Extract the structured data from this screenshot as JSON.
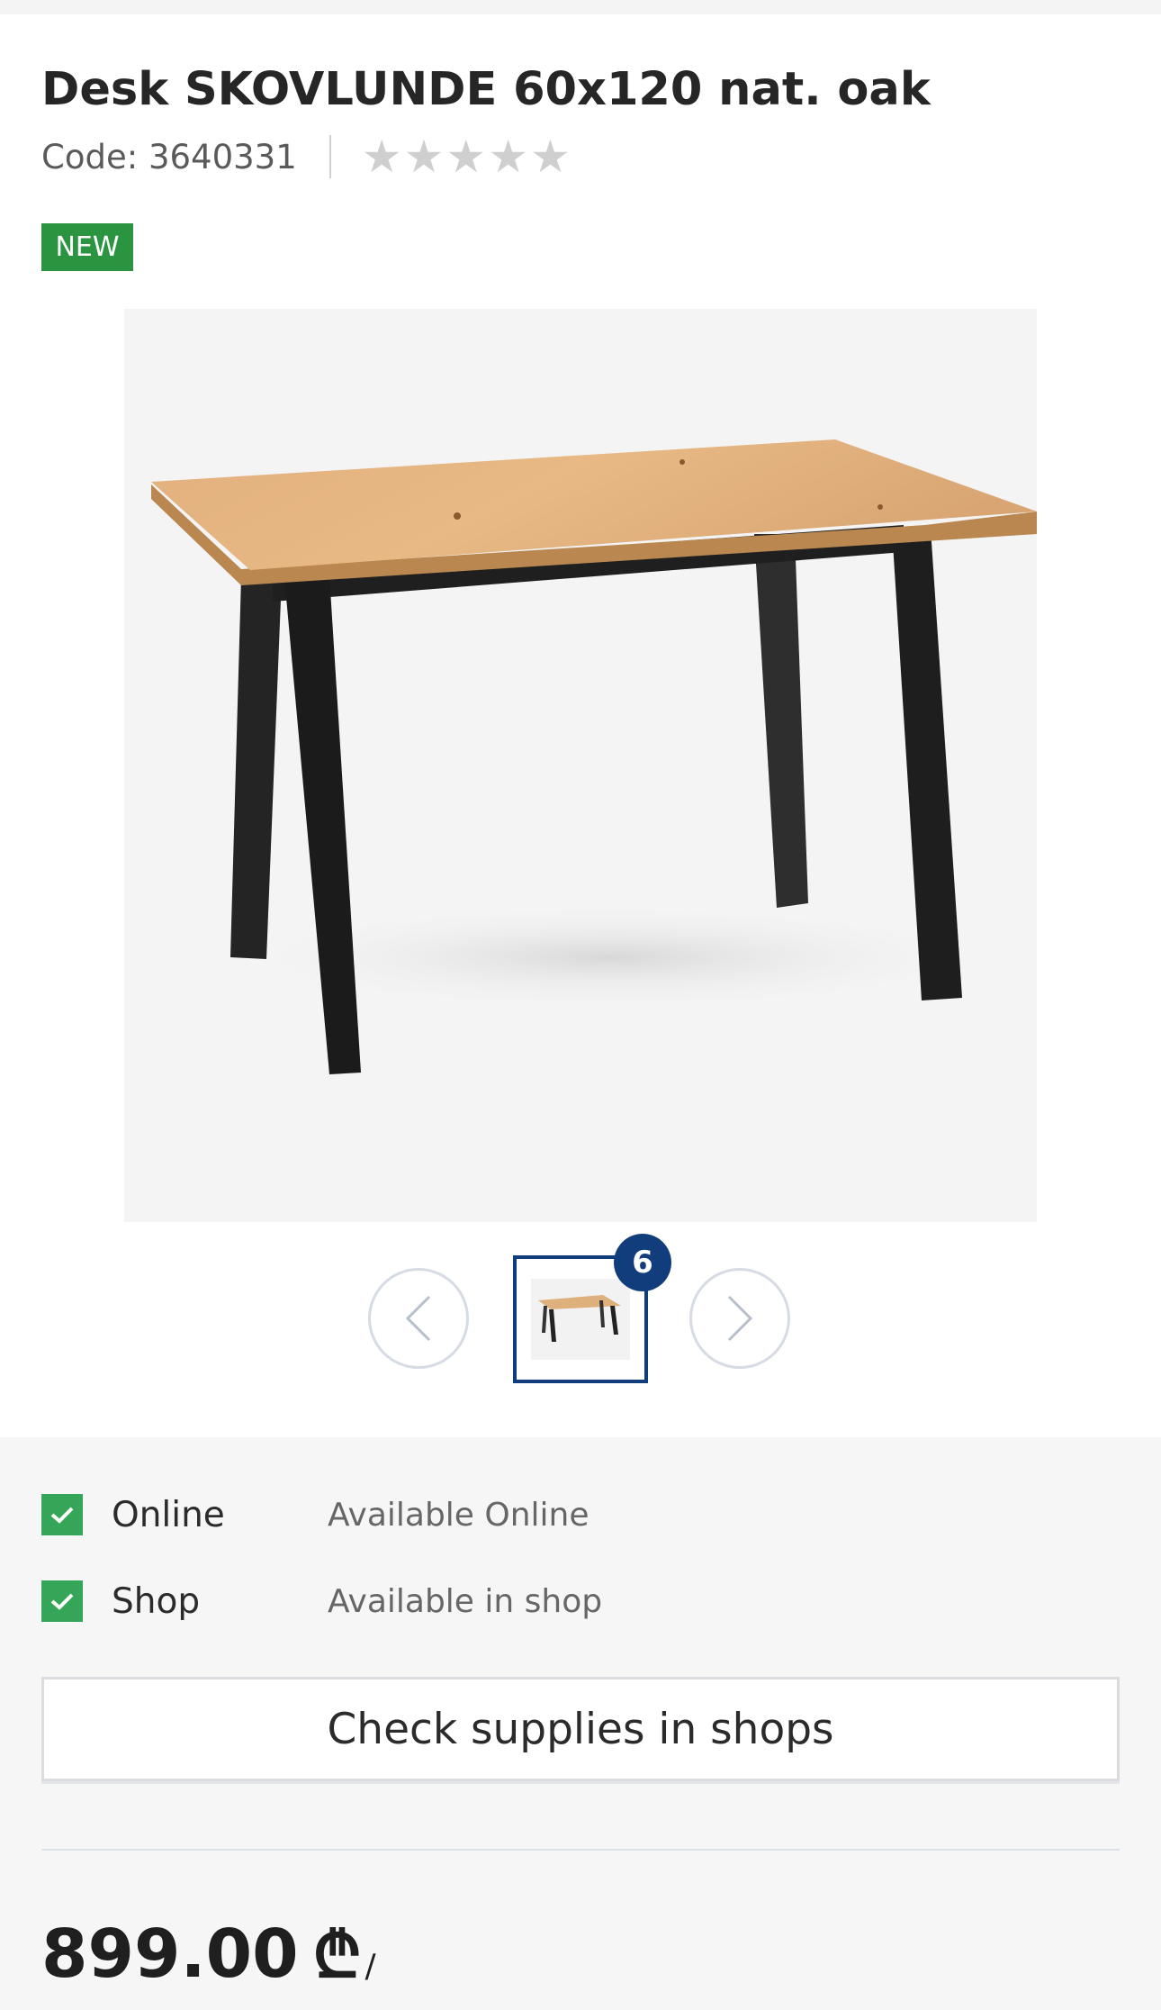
{
  "product": {
    "title": "Desk SKOVLUNDE 60x120 nat. oak",
    "code": "Code: 3640331",
    "rating_stars": 5,
    "rating_value": 0,
    "badge": "NEW"
  },
  "gallery": {
    "image_count": "6",
    "dots_total": 6,
    "active_dot": 1,
    "main_image_icon": "desk-photo",
    "prev_icon": "chevron-left-icon",
    "next_icon": "chevron-right-icon"
  },
  "availability": [
    {
      "label": "Online",
      "status": "Available Online",
      "checked": true
    },
    {
      "label": "Shop",
      "status": "Available in shop",
      "checked": true
    }
  ],
  "actions": {
    "check_supplies": "Check supplies in shops"
  },
  "price": {
    "value": "899.00",
    "currency": "₾",
    "unit": "/"
  },
  "colors": {
    "brand_blue": "#123d7c",
    "badge_green": "#2a9441",
    "check_green": "#35a557"
  }
}
